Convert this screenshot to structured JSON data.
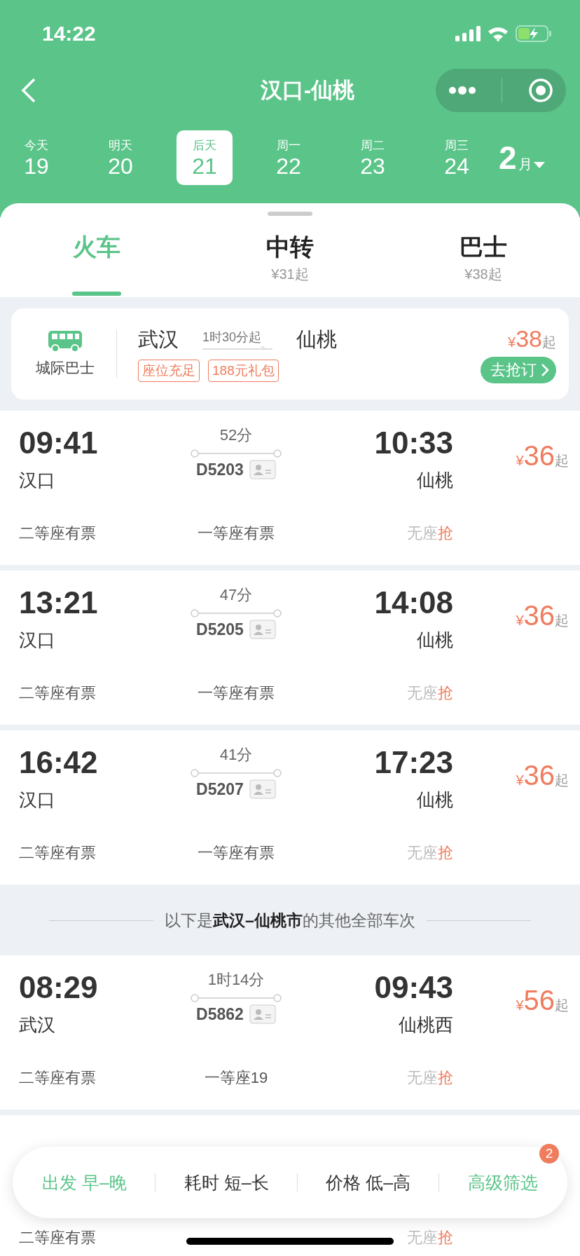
{
  "status_bar": {
    "time": "14:22"
  },
  "nav": {
    "title": "汉口-仙桃"
  },
  "dates": [
    {
      "label": "今天",
      "day": "19",
      "selected": false
    },
    {
      "label": "明天",
      "day": "20",
      "selected": false
    },
    {
      "label": "后天",
      "day": "21",
      "selected": true
    },
    {
      "label": "周一",
      "day": "22",
      "selected": false
    },
    {
      "label": "周二",
      "day": "23",
      "selected": false
    },
    {
      "label": "周三",
      "day": "24",
      "selected": false
    }
  ],
  "month": {
    "number": "2",
    "unit": "月"
  },
  "tabs": [
    {
      "label": "火车",
      "selected": true
    },
    {
      "label": "中转",
      "sub": "¥31起",
      "selected": false
    },
    {
      "label": "巴士",
      "sub": "¥38起",
      "selected": false
    }
  ],
  "bus_card": {
    "label": "城际巴士",
    "from": "武汉",
    "duration": "1时30分起",
    "to": "仙桃",
    "tags": [
      "座位充足",
      "188元礼包"
    ],
    "currency": "¥",
    "price": "38",
    "suffix": "起",
    "button": "去抢订"
  },
  "trains": [
    {
      "dep_time": "09:41",
      "duration": "52分",
      "arr_time": "10:33",
      "dep_station": "汉口",
      "train_no": "D5203",
      "arr_station": "仙桃",
      "currency": "¥",
      "price": "36",
      "suffix": "起",
      "seat_1": "二等座有票",
      "seat_2": "一等座有票",
      "seat_3": "无座",
      "seat_3_action": "抢"
    },
    {
      "dep_time": "13:21",
      "duration": "47分",
      "arr_time": "14:08",
      "dep_station": "汉口",
      "train_no": "D5205",
      "arr_station": "仙桃",
      "currency": "¥",
      "price": "36",
      "suffix": "起",
      "seat_1": "二等座有票",
      "seat_2": "一等座有票",
      "seat_3": "无座",
      "seat_3_action": "抢"
    },
    {
      "dep_time": "16:42",
      "duration": "41分",
      "arr_time": "17:23",
      "dep_station": "汉口",
      "train_no": "D5207",
      "arr_station": "仙桃",
      "currency": "¥",
      "price": "36",
      "suffix": "起",
      "seat_1": "二等座有票",
      "seat_2": "一等座有票",
      "seat_3": "无座",
      "seat_3_action": "抢"
    }
  ],
  "other_divider": "以下是**武汉–仙桃市**的其他全部车次",
  "other_trains": [
    {
      "dep_time": "08:29",
      "duration": "1时14分",
      "arr_time": "09:43",
      "dep_station": "武汉",
      "train_no": "D5862",
      "arr_station": "仙桃西",
      "currency": "¥",
      "price": "56",
      "suffix": "起",
      "seat_1": "二等座有票",
      "seat_2": "一等座19",
      "seat_3": "无座",
      "seat_3_action": "抢"
    },
    {
      "seat_1": "二等座有票",
      "seat_3": "无座",
      "seat_3_action": "抢"
    }
  ],
  "filter_bar": [
    {
      "label": "出发 早–晚",
      "active": true
    },
    {
      "label": "耗时 短–长",
      "active": false
    },
    {
      "label": "价格 低–高",
      "active": false
    },
    {
      "label": "高级筛选",
      "active": true,
      "badge": "2"
    }
  ]
}
